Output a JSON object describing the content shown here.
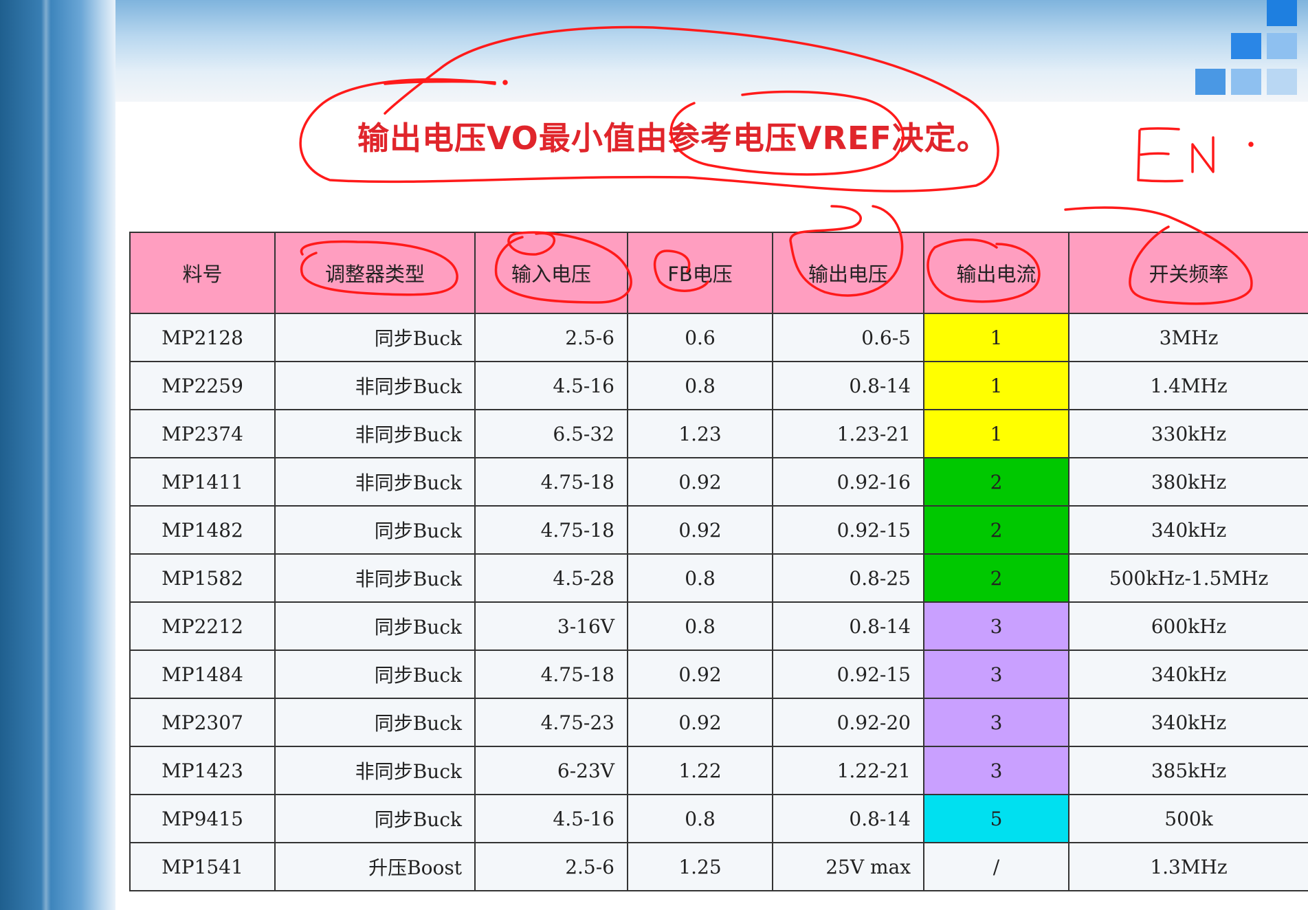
{
  "title": "输出电压VO最小值由参考电压VREF决定。",
  "handwriting": "EN",
  "table": {
    "headers": [
      "料号",
      "调整器类型",
      "输入电压",
      "FB电压",
      "输出电压",
      "输出电流",
      "开关频率"
    ],
    "rows": [
      [
        "MP2128",
        "同步Buck",
        "2.5-6",
        "0.6",
        "0.6-5",
        "1",
        "3MHz"
      ],
      [
        "MP2259",
        "非同步Buck",
        "4.5-16",
        "0.8",
        "0.8-14",
        "1",
        "1.4MHz"
      ],
      [
        "MP2374",
        "非同步Buck",
        "6.5-32",
        "1.23",
        "1.23-21",
        "1",
        "330kHz"
      ],
      [
        "MP1411",
        "非同步Buck",
        "4.75-18",
        "0.92",
        "0.92-16",
        "2",
        "380kHz"
      ],
      [
        "MP1482",
        "同步Buck",
        "4.75-18",
        "0.92",
        "0.92-15",
        "2",
        "340kHz"
      ],
      [
        "MP1582",
        "非同步Buck",
        "4.5-28",
        "0.8",
        "0.8-25",
        "2",
        "500kHz-1.5MHz"
      ],
      [
        "MP2212",
        "同步Buck",
        "3-16V",
        "0.8",
        "0.8-14",
        "3",
        "600kHz"
      ],
      [
        "MP1484",
        "同步Buck",
        "4.75-18",
        "0.92",
        "0.92-15",
        "3",
        "340kHz"
      ],
      [
        "MP2307",
        "同步Buck",
        "4.75-23",
        "0.92",
        "0.92-20",
        "3",
        "340kHz"
      ],
      [
        "MP1423",
        "非同步Buck",
        "6-23V",
        "1.22",
        "1.22-21",
        "3",
        "385kHz"
      ],
      [
        "MP9415",
        "同步Buck",
        "4.5-16",
        "0.8",
        "0.8-14",
        "5",
        "500k"
      ],
      [
        "MP1541",
        "升压Boost",
        "2.5-6",
        "1.25",
        "25V max",
        "/",
        "1.3MHz"
      ]
    ],
    "current_colors": {
      "1": "#ffff00",
      "2": "#00c800",
      "3": "#c9a0ff",
      "5": "#00e0f0",
      "/": "#f4f7fa"
    }
  },
  "colors": {
    "title": "#e0252b",
    "header_bg": "#ff9ec0",
    "ink": "#ff1a1a"
  }
}
